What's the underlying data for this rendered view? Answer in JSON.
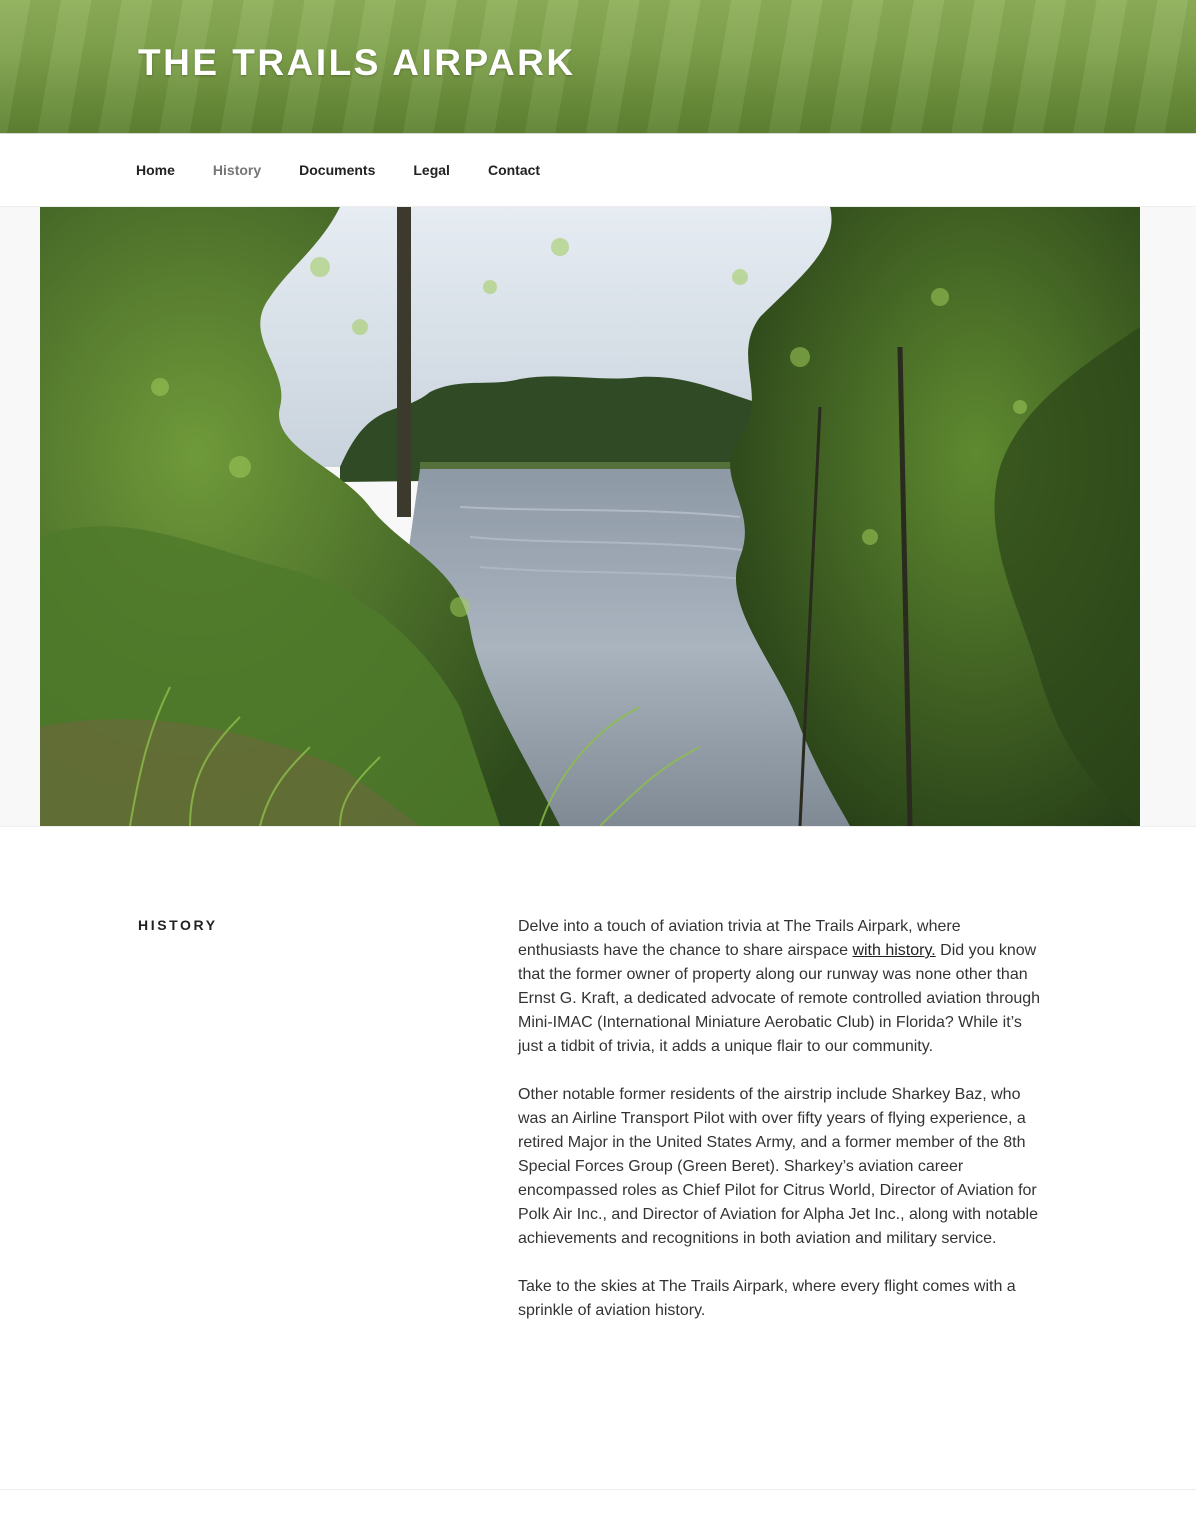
{
  "site": {
    "title": "THE TRAILS AIRPARK"
  },
  "nav": {
    "items": [
      {
        "label": "Home",
        "current": false
      },
      {
        "label": "History",
        "current": true
      },
      {
        "label": "Documents",
        "current": false
      },
      {
        "label": "Legal",
        "current": false
      },
      {
        "label": "Contact",
        "current": false
      }
    ]
  },
  "hero": {
    "alt": "river view through trees"
  },
  "page": {
    "title": "HISTORY",
    "p1_before": "Delve into a touch of aviation trivia at The Trails Airpark, where enthusiasts have the chance to share airspace ",
    "p1_link": "with history.",
    "p1_after": " Did you know that the former owner of property along our runway was none other than Ernst G. Kraft, a dedicated advocate of remote controlled aviation through Mini-IMAC (International Miniature Aerobatic Club) in Florida? While it’s just a tidbit of trivia, it adds a unique flair to our community.",
    "p2": "Other notable former residents of the airstrip include Sharkey Baz, who was an Airline Transport Pilot with over fifty years of flying experience, a retired Major in the United States Army, and a former member of the 8th Special Forces Group (Green Beret). Sharkey’s aviation career encompassed roles as Chief Pilot for Citrus World, Director of Aviation for Polk Air Inc., and Director of Aviation for Alpha Jet Inc., along with notable achievements and recognitions in both aviation and military service.",
    "p3": "Take to the skies at The Trails Airpark, where every flight comes with a sprinkle of aviation history."
  }
}
